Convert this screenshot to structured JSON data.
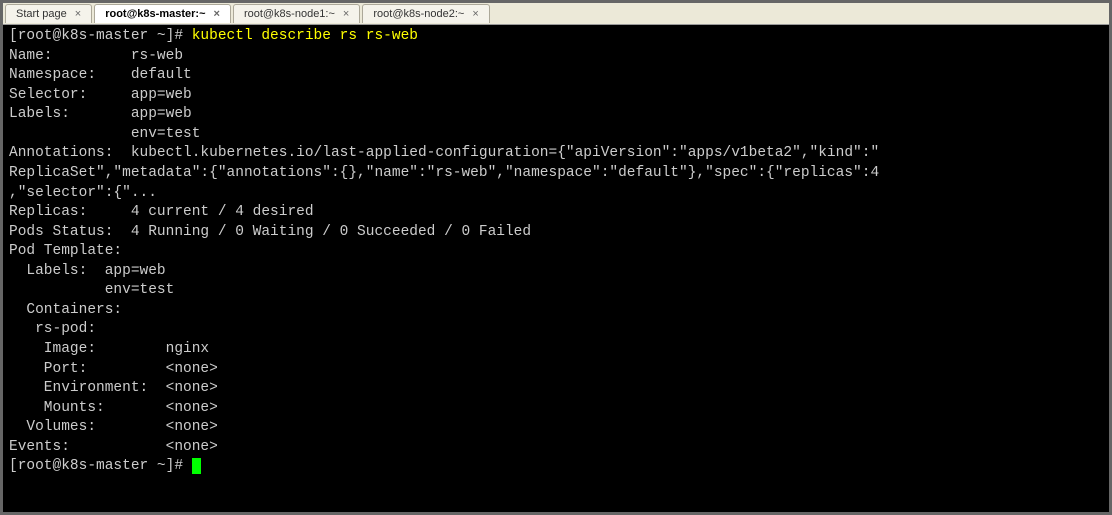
{
  "tabs": [
    {
      "label": "Start page",
      "active": false
    },
    {
      "label": "root@k8s-master:~",
      "active": true
    },
    {
      "label": "root@k8s-node1:~",
      "active": false
    },
    {
      "label": "root@k8s-node2:~",
      "active": false
    }
  ],
  "terminal": {
    "prompt1": "[root@k8s-master ~]# ",
    "command": "kubectl describe rs rs-web",
    "prompt2": "[root@k8s-master ~]# ",
    "lines": [
      "Name:         rs-web",
      "Namespace:    default",
      "Selector:     app=web",
      "Labels:       app=web",
      "              env=test",
      "Annotations:  kubectl.kubernetes.io/last-applied-configuration={\"apiVersion\":\"apps/v1beta2\",\"kind\":\"",
      "ReplicaSet\",\"metadata\":{\"annotations\":{},\"name\":\"rs-web\",\"namespace\":\"default\"},\"spec\":{\"replicas\":4",
      ",\"selector\":{\"...",
      "Replicas:     4 current / 4 desired",
      "Pods Status:  4 Running / 0 Waiting / 0 Succeeded / 0 Failed",
      "Pod Template:",
      "  Labels:  app=web",
      "           env=test",
      "  Containers:",
      "   rs-pod:",
      "    Image:        nginx",
      "    Port:         <none>",
      "    Environment:  <none>",
      "    Mounts:       <none>",
      "  Volumes:        <none>",
      "Events:           <none>"
    ]
  }
}
